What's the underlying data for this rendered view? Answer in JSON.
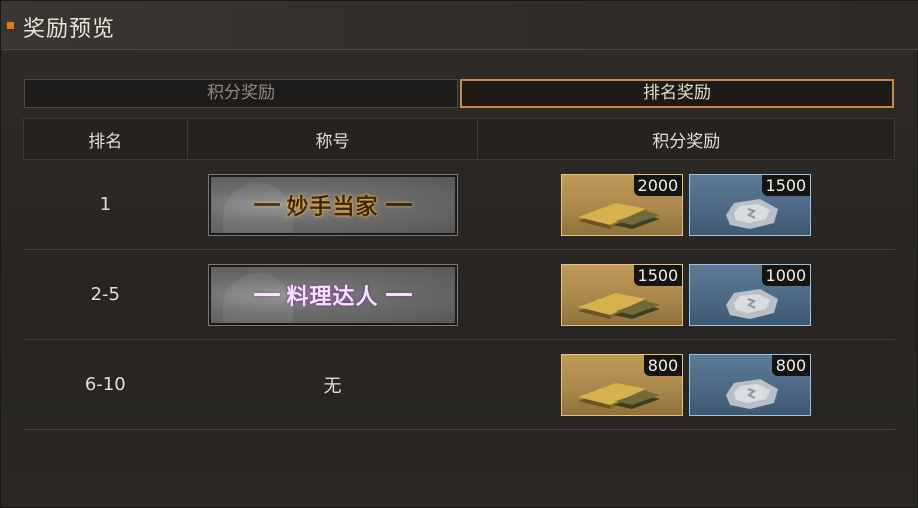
{
  "window": {
    "title": "奖励预览"
  },
  "tabs": [
    {
      "label": "积分奖励",
      "active": false
    },
    {
      "label": "排名奖励",
      "active": true
    }
  ],
  "table": {
    "headers": [
      "排名",
      "称号",
      "积分奖励"
    ],
    "rows": [
      {
        "rank": "1",
        "title": "妙手当家",
        "title_style": "gold",
        "gold_qty": "2000",
        "silver_qty": "1500"
      },
      {
        "rank": "2-5",
        "title": "料理达人",
        "title_style": "purple",
        "gold_qty": "1500",
        "silver_qty": "1000"
      },
      {
        "rank": "6-10",
        "title": "无",
        "title_style": "none",
        "gold_qty": "800",
        "silver_qty": "800"
      }
    ]
  },
  "icons": {
    "gold_item": "gold-bar-icon",
    "silver_item": "silver-ore-icon"
  },
  "colors": {
    "accent": "#e07a22",
    "active_tab_border": "#c98a45",
    "gold_item_border": "#e8c47a",
    "silver_item_border": "#9cc3e6"
  }
}
